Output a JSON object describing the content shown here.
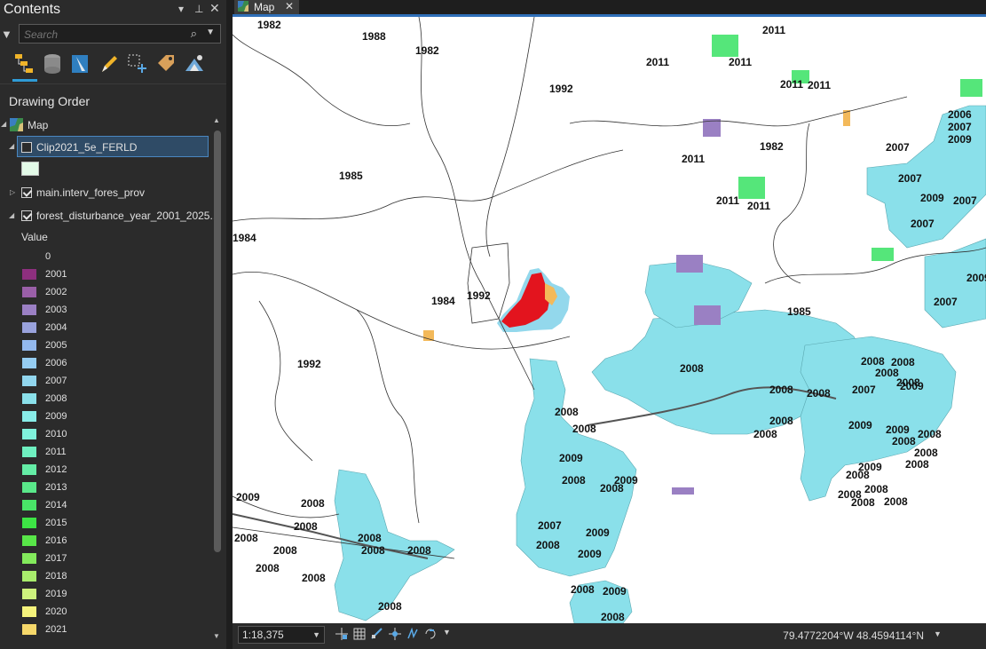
{
  "contents": {
    "title": "Contents",
    "window_controls": [
      "chevron-down-icon",
      "pin-icon",
      "close-icon"
    ],
    "search": {
      "placeholder": "Search"
    },
    "toolbar": [
      "list-by-drawing-order-icon",
      "list-by-source-icon",
      "list-by-selection-icon",
      "list-by-editing-icon",
      "list-by-snapping-icon",
      "list-by-labeling-icon",
      "list-by-perspective-icon"
    ],
    "section_title": "Drawing Order",
    "tree": {
      "map": "Map",
      "layer1": "Clip2021_5e_FERLD",
      "layer1_symbol_color": "#e3fae8",
      "layer2": "main.interv_fores_prov",
      "layer3": "forest_disturbance_year_2001_2025...",
      "value_label": "Value"
    },
    "legend": [
      {
        "label": "0",
        "color": null
      },
      {
        "label": "2001",
        "color": "#8e2f7e"
      },
      {
        "label": "2002",
        "color": "#9a5fa8"
      },
      {
        "label": "2003",
        "color": "#9b80c4"
      },
      {
        "label": "2004",
        "color": "#99a2dc"
      },
      {
        "label": "2005",
        "color": "#93b9ee"
      },
      {
        "label": "2006",
        "color": "#95cdf2"
      },
      {
        "label": "2007",
        "color": "#91d6ee"
      },
      {
        "label": "2008",
        "color": "#8ae0ea"
      },
      {
        "label": "2009",
        "color": "#88ece8"
      },
      {
        "label": "2010",
        "color": "#7ff2dc"
      },
      {
        "label": "2011",
        "color": "#6ef0c0"
      },
      {
        "label": "2012",
        "color": "#64eda6"
      },
      {
        "label": "2013",
        "color": "#5ae88a"
      },
      {
        "label": "2014",
        "color": "#49e468"
      },
      {
        "label": "2015",
        "color": "#3de445"
      },
      {
        "label": "2016",
        "color": "#58e648"
      },
      {
        "label": "2017",
        "color": "#83ea5c"
      },
      {
        "label": "2018",
        "color": "#a8ed6c"
      },
      {
        "label": "2019",
        "color": "#cdf27d"
      },
      {
        "label": "2020",
        "color": "#f5f37c"
      },
      {
        "label": "2021",
        "color": "#f6d86a"
      }
    ]
  },
  "map_view": {
    "tab_label": "Map",
    "colors": {
      "cutblock": "#8ae0ea",
      "fire": "#e3141e",
      "green": "#55e67a",
      "purple": "#9a80c3"
    },
    "labels": [
      "1982",
      "1988",
      "1982",
      "2011",
      "2011",
      "2011",
      "2011",
      "2011",
      "1992",
      "1985",
      "2011",
      "1982",
      "2011",
      "2011",
      "2006",
      "2007",
      "2009",
      "2007",
      "2007",
      "2009",
      "2007",
      "2007",
      "1984",
      "1984",
      "1992",
      "2009",
      "2007",
      "1985",
      "1992",
      "2008",
      "2008",
      "2008",
      "2008",
      "2009",
      "2008",
      "2008",
      "2007",
      "2008",
      "2008",
      "2008",
      "2008",
      "2008",
      "2009",
      "2009",
      "2008",
      "2008",
      "2008",
      "2009",
      "2008",
      "2009",
      "2008",
      "2008",
      "2009",
      "2008",
      "2008",
      "2009",
      "2008",
      "2008",
      "2008",
      "2008",
      "2008",
      "2008",
      "2008",
      "2008",
      "2008",
      "2008",
      "2008",
      "2008",
      "2008",
      "2007",
      "2008",
      "2009",
      "2009",
      "2008",
      "2009",
      "2008"
    ],
    "scale": "1:18,375",
    "coordinates": "79.4772204°W 48.4594114°N"
  }
}
